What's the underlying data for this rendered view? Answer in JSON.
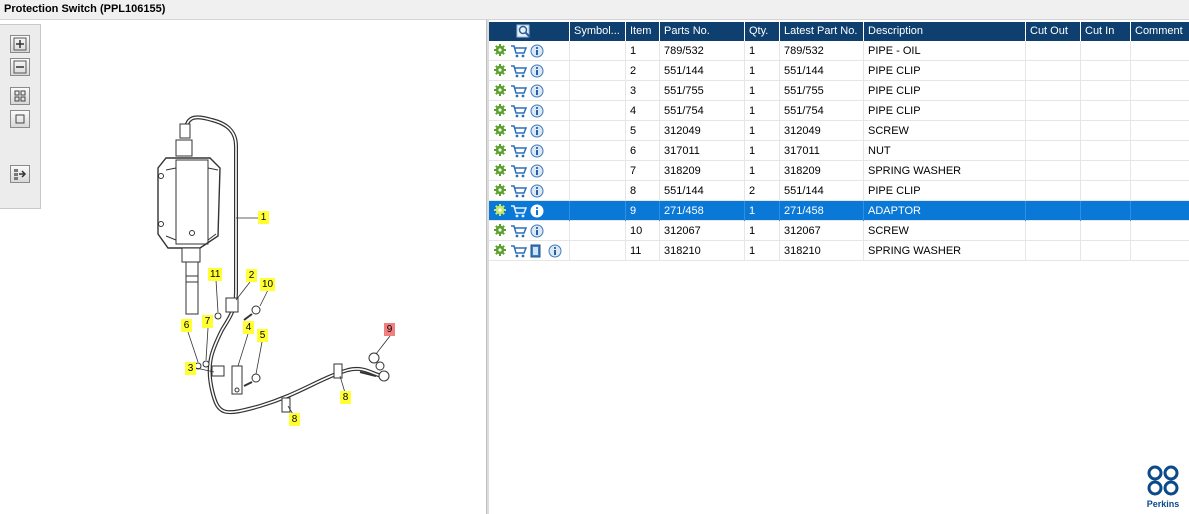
{
  "window": {
    "title": "Protection Switch (PPL106155)"
  },
  "toolbar": {
    "buttons": [
      {
        "name": "zoom-in",
        "icon": "zoom-in-icon"
      },
      {
        "name": "zoom-out",
        "icon": "zoom-out-icon"
      },
      {
        "name": "fit-window",
        "icon": "fit-window-icon"
      },
      {
        "name": "actual-size",
        "icon": "actual-size-icon"
      },
      {
        "name": "export",
        "icon": "export-icon"
      }
    ]
  },
  "diagram": {
    "callouts": [
      "1",
      "2",
      "3",
      "4",
      "5",
      "6",
      "7",
      "8",
      "8",
      "9",
      "10",
      "11"
    ],
    "selected_callout": "9",
    "highlight_color": "#ffff33",
    "selected_color": "#f08080"
  },
  "table": {
    "header_icon": "search-catalog-icon",
    "columns": [
      "Symbol...",
      "Item",
      "Parts No.",
      "Qty.",
      "Latest Part No.",
      "Description",
      "Cut Out",
      "Cut In",
      "Comment"
    ],
    "rows": [
      {
        "item": "1",
        "part_no": "789/532",
        "qty": "1",
        "latest": "789/532",
        "description": "PIPE - OIL",
        "cut_out": "",
        "cut_in": "",
        "comment": ""
      },
      {
        "item": "2",
        "part_no": "551/144",
        "qty": "1",
        "latest": "551/144",
        "description": "PIPE CLIP",
        "cut_out": "",
        "cut_in": "",
        "comment": ""
      },
      {
        "item": "3",
        "part_no": "551/755",
        "qty": "1",
        "latest": "551/755",
        "description": "PIPE CLIP",
        "cut_out": "",
        "cut_in": "",
        "comment": ""
      },
      {
        "item": "4",
        "part_no": "551/754",
        "qty": "1",
        "latest": "551/754",
        "description": "PIPE CLIP",
        "cut_out": "",
        "cut_in": "",
        "comment": ""
      },
      {
        "item": "5",
        "part_no": "312049",
        "qty": "1",
        "latest": "312049",
        "description": "SCREW",
        "cut_out": "",
        "cut_in": "",
        "comment": ""
      },
      {
        "item": "6",
        "part_no": "317011",
        "qty": "1",
        "latest": "317011",
        "description": "NUT",
        "cut_out": "",
        "cut_in": "",
        "comment": ""
      },
      {
        "item": "7",
        "part_no": "318209",
        "qty": "1",
        "latest": "318209",
        "description": "SPRING WASHER",
        "cut_out": "",
        "cut_in": "",
        "comment": ""
      },
      {
        "item": "8",
        "part_no": "551/144",
        "qty": "2",
        "latest": "551/144",
        "description": "PIPE CLIP",
        "cut_out": "",
        "cut_in": "",
        "comment": ""
      },
      {
        "item": "9",
        "part_no": "271/458",
        "qty": "1",
        "latest": "271/458",
        "description": "ADAPTOR",
        "cut_out": "",
        "cut_in": "",
        "comment": "",
        "selected": true
      },
      {
        "item": "10",
        "part_no": "312067",
        "qty": "1",
        "latest": "312067",
        "description": "SCREW",
        "cut_out": "",
        "cut_in": "",
        "comment": ""
      },
      {
        "item": "11",
        "part_no": "318210",
        "qty": "1",
        "latest": "318210",
        "description": "SPRING WASHER",
        "cut_out": "",
        "cut_in": "",
        "comment": "",
        "has_doc": true
      }
    ],
    "row_icons": [
      "gear-icon",
      "cart-icon",
      "info-icon"
    ],
    "header_bg": "#0e3f6e",
    "selected_bg": "#0a78d7"
  },
  "logo": {
    "text": "Perkins",
    "icon": "perkins-logo-icon",
    "color": "#0c4a8a"
  }
}
